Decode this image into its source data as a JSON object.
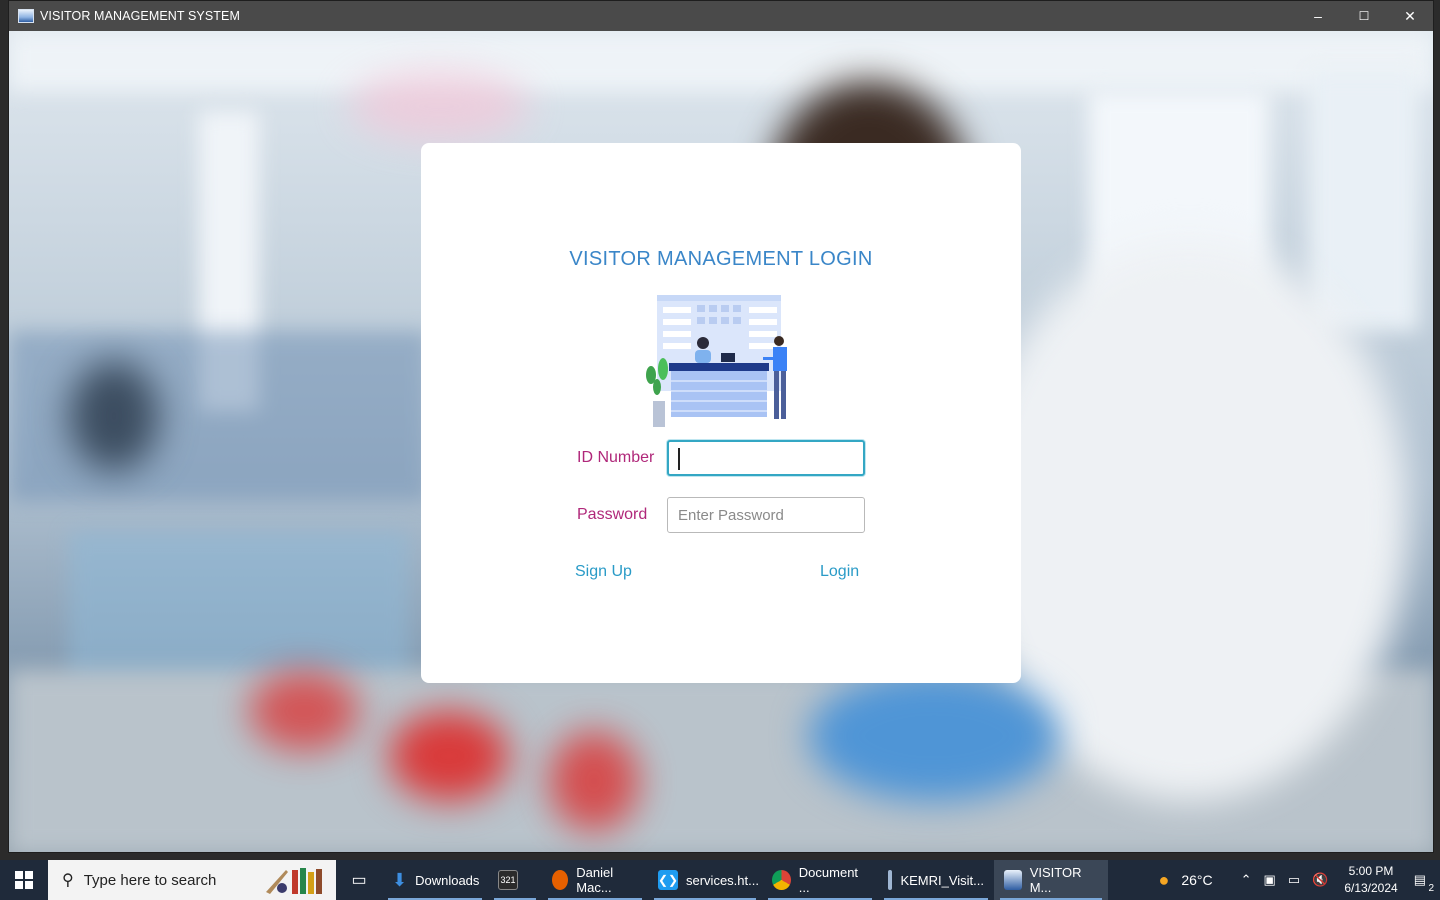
{
  "window": {
    "title": "VISITOR MANAGEMENT SYSTEM",
    "controls": {
      "minimize": "–",
      "maximize": "☐",
      "close": "✕"
    }
  },
  "login": {
    "heading": "VISITOR MANAGEMENT LOGIN",
    "id_label": "ID Number",
    "id_value": "",
    "password_label": "Password",
    "password_placeholder": "Enter Password",
    "signup_label": "Sign Up",
    "login_label": "Login"
  },
  "taskbar": {
    "search_placeholder": "Type here to search",
    "apps": [
      {
        "label": "Downloads",
        "icon": "download-icon",
        "color": "#3d8ee0"
      },
      {
        "label": "",
        "icon": "calendar-icon",
        "color": "#2b2b2b"
      },
      {
        "label": "Daniel Mac...",
        "icon": "firefox-icon",
        "color": "#e66000"
      },
      {
        "label": "services.ht...",
        "icon": "vscode-icon",
        "color": "#1f9cf0"
      },
      {
        "label": "Document ...",
        "icon": "chrome-icon",
        "color": "#db4437"
      },
      {
        "label": "KEMRI_Visit...",
        "icon": "cube-icon",
        "color": "#9fb6d3"
      },
      {
        "label": "VISITOR M...",
        "icon": "java-app-icon",
        "color": "#8fb4e3"
      }
    ],
    "weather": "26°C",
    "time": "5:00 PM",
    "date": "6/13/2024",
    "notifications": "2"
  }
}
